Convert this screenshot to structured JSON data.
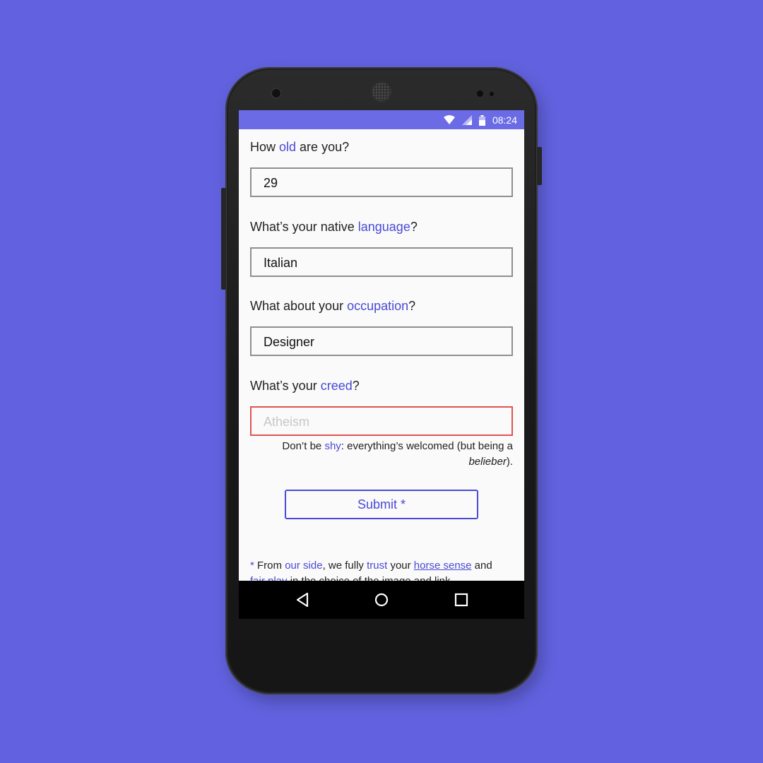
{
  "status_bar": {
    "time": "08:24",
    "icons": [
      "wifi-icon",
      "signal-icon",
      "battery-icon"
    ]
  },
  "form": {
    "q1": {
      "before": "How ",
      "accent": "old",
      "after": " are you?",
      "value": "29"
    },
    "q2": {
      "before": "What’s your native ",
      "accent": "language",
      "after": "?",
      "value": "Italian"
    },
    "q3": {
      "before": "What about your ",
      "accent": "occupation",
      "after": "?",
      "value": "Designer"
    },
    "q4": {
      "before": "What’s your ",
      "accent": "creed",
      "after": "?",
      "value": "",
      "placeholder": "Atheism"
    },
    "hint": {
      "part1": "Don’t be ",
      "accent": "shy",
      "part2": ": everything’s welcomed (but being a ",
      "italic": "belieber",
      "part3": ")."
    },
    "submit_label": "Submit *"
  },
  "footnote": {
    "star": "*",
    "t1": " From ",
    "a1": "our side",
    "t2": ", we fully ",
    "a2": "trust",
    "t3": " your ",
    "link1": "horse sense",
    "t4": " and ",
    "link2": "fair play",
    "t5": " in the choice of the image and link."
  },
  "navbar": {
    "icons": [
      "back-icon",
      "home-icon",
      "recents-icon"
    ]
  },
  "colors": {
    "background": "#6262e0",
    "accent": "#4a4ad6",
    "status_bar": "#6b6be6",
    "error": "#e05353"
  }
}
